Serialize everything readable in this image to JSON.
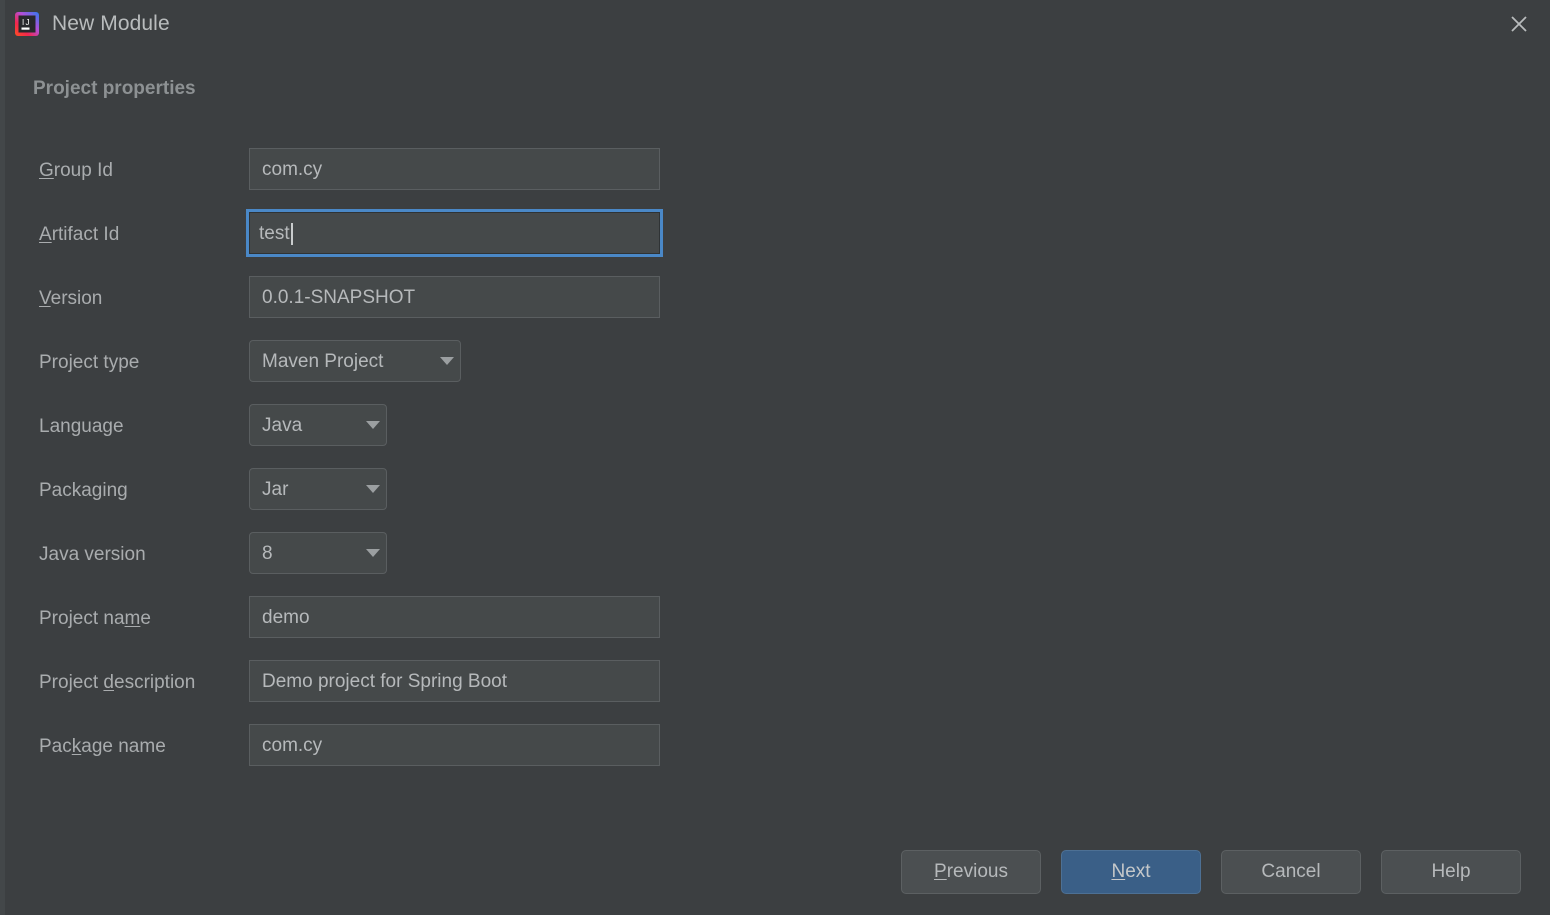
{
  "window": {
    "title": "New Module",
    "app_icon": "intellij-idea-icon",
    "close_icon": "close-icon",
    "background_color": "#3c3f41"
  },
  "section": {
    "heading": "Project properties"
  },
  "form": {
    "fields": [
      {
        "type": "text",
        "name": "group-id",
        "label_pre": "",
        "label_mnemonic": "G",
        "label_post": "roup Id",
        "label_full": "Group Id",
        "value": "com.cy",
        "focused": false
      },
      {
        "type": "text",
        "name": "artifact-id",
        "label_pre": "",
        "label_mnemonic": "A",
        "label_post": "rtifact Id",
        "label_full": "Artifact Id",
        "value": "test",
        "focused": true
      },
      {
        "type": "text",
        "name": "version",
        "label_pre": "",
        "label_mnemonic": "V",
        "label_post": "ersion",
        "label_full": "Version",
        "value": "0.0.1-SNAPSHOT",
        "focused": false
      },
      {
        "type": "combo",
        "name": "project-type",
        "label_pre": "Project type",
        "label_mnemonic": "",
        "label_post": "",
        "label_full": "Project type",
        "value": "Maven Project",
        "width": "wide"
      },
      {
        "type": "combo",
        "name": "language",
        "label_pre": "Language",
        "label_mnemonic": "",
        "label_post": "",
        "label_full": "Language",
        "value": "Java",
        "width": "narrow"
      },
      {
        "type": "combo",
        "name": "packaging",
        "label_pre": "Packaging",
        "label_mnemonic": "",
        "label_post": "",
        "label_full": "Packaging",
        "value": "Jar",
        "width": "narrow"
      },
      {
        "type": "combo",
        "name": "java-version",
        "label_pre": "Java version",
        "label_mnemonic": "",
        "label_post": "",
        "label_full": "Java version",
        "value": "8",
        "width": "narrow"
      },
      {
        "type": "text",
        "name": "project-name",
        "label_pre": "Project na",
        "label_mnemonic": "m",
        "label_post": "e",
        "label_full": "Project name",
        "value": "demo",
        "focused": false
      },
      {
        "type": "text",
        "name": "project-description",
        "label_pre": "Project ",
        "label_mnemonic": "d",
        "label_post": "escription",
        "label_full": "Project description",
        "value": "Demo project for Spring Boot",
        "focused": false
      },
      {
        "type": "text",
        "name": "package-name",
        "label_pre": "Pac",
        "label_mnemonic": "k",
        "label_post": "age name",
        "label_full": "Package name",
        "value": "com.cy",
        "focused": false
      }
    ]
  },
  "footer": {
    "buttons": [
      {
        "name": "previous",
        "pre": "",
        "mnemonic": "P",
        "post": "revious",
        "full": "Previous",
        "default": false
      },
      {
        "name": "next",
        "pre": "",
        "mnemonic": "N",
        "post": "ext",
        "full": "Next",
        "default": true
      },
      {
        "name": "cancel",
        "pre": "Cancel",
        "mnemonic": "",
        "post": "",
        "full": "Cancel",
        "default": false
      },
      {
        "name": "help",
        "pre": "Help",
        "mnemonic": "",
        "post": "",
        "full": "Help",
        "default": false
      }
    ],
    "default_button_color": "#3a5f87"
  }
}
